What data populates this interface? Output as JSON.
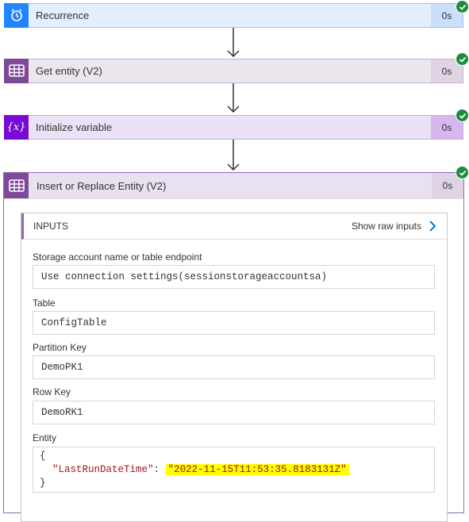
{
  "steps": [
    {
      "title": "Recurrence",
      "duration": "0s",
      "icon": "alarm-clock-icon"
    },
    {
      "title": "Get entity (V2)",
      "duration": "0s",
      "icon": "table-storage-icon"
    },
    {
      "title": "Initialize variable",
      "duration": "0s",
      "icon": "variable-icon",
      "icon_text": "{x}"
    },
    {
      "title": "Insert or Replace Entity (V2)",
      "duration": "0s",
      "icon": "table-storage-icon"
    }
  ],
  "inputs": {
    "header": "INPUTS",
    "show_raw": "Show raw inputs",
    "fields": [
      {
        "label": "Storage account name or table endpoint",
        "value": "Use connection settings(sessionstorageaccountsa)"
      },
      {
        "label": "Table",
        "value": "ConfigTable"
      },
      {
        "label": "Partition Key",
        "value": "DemoPK1"
      },
      {
        "label": "Row Key",
        "value": "DemoRK1"
      }
    ],
    "entity": {
      "label": "Entity",
      "open_brace": "{",
      "key": "\"LastRunDateTime\"",
      "colon": ":",
      "value": "\"2022-11-15T11:53:35.8183131Z\"",
      "close_brace": "}"
    }
  },
  "colors": {
    "recurrence_bg": "#e3effd",
    "recurrence_icon": "#1f85ff",
    "entity_bg": "#ece6ee",
    "entity_icon": "#804998",
    "variable_bg": "#ece1f5",
    "variable_icon": "#770bd6",
    "success": "#1d8c3c",
    "highlight": "#ffff00",
    "json_key": "#a31515",
    "json_value": "#a31515"
  }
}
